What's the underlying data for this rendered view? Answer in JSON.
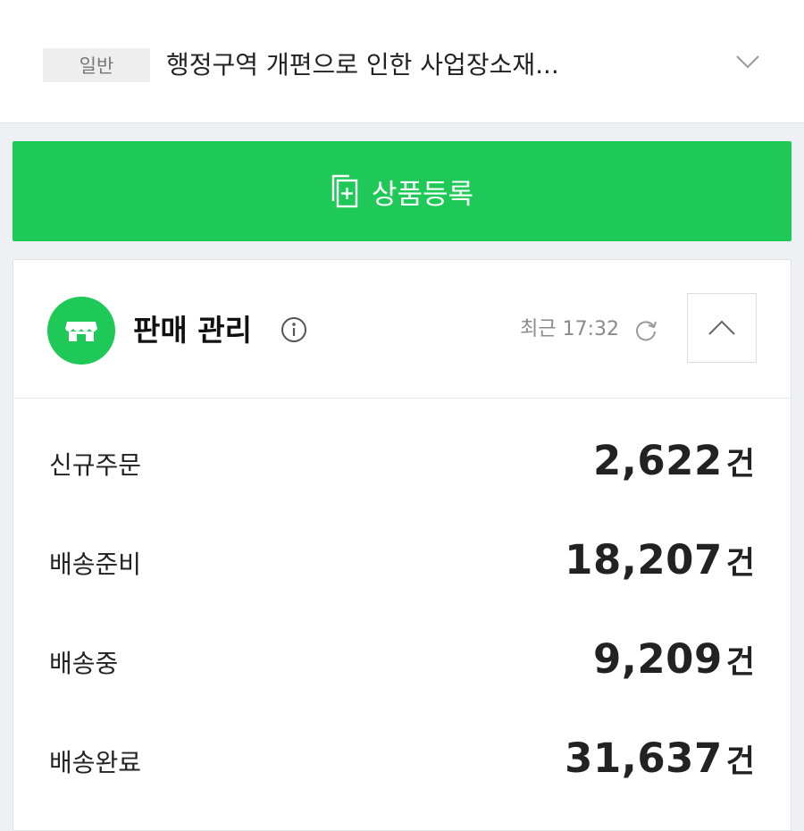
{
  "notice": {
    "badge": "일반",
    "text": "행정구역 개편으로 인한 사업장소재...",
    "icon": "chevron-down-icon"
  },
  "register_button": {
    "label": "상품등록",
    "icon": "add-document-icon",
    "color": "#1fc958"
  },
  "sales_panel": {
    "title": "판매 관리",
    "icon": "store-icon",
    "updated_text": "최근 17:32",
    "stats": [
      {
        "label": "신규주문",
        "value": "2,622",
        "unit": "건"
      },
      {
        "label": "배송준비",
        "value": "18,207",
        "unit": "건"
      },
      {
        "label": "배송중",
        "value": "9,209",
        "unit": "건"
      },
      {
        "label": "배송완료",
        "value": "31,637",
        "unit": "건"
      }
    ]
  },
  "colors": {
    "accent": "#1fc958",
    "background": "#eef0f3",
    "text": "#222222",
    "muted": "#8a8a8a"
  }
}
